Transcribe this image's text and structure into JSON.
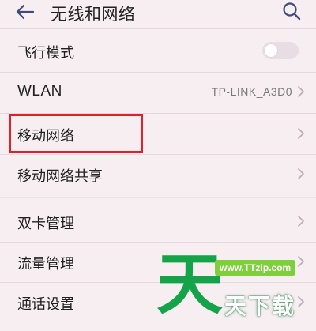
{
  "header": {
    "title": "无线和网络",
    "back_icon": "arrow-left-icon",
    "search_icon": "search-icon"
  },
  "settings": [
    {
      "label": "飞行模式",
      "type": "toggle",
      "checked": false
    },
    {
      "label": "WLAN",
      "type": "link",
      "value": "TP-LINK_A3D0"
    },
    {
      "label": "移动网络",
      "type": "link",
      "highlighted": true
    },
    {
      "label": "移动网络共享",
      "type": "link"
    },
    {
      "label": "双卡管理",
      "type": "link"
    },
    {
      "label": "流量管理",
      "type": "link"
    },
    {
      "label": "通话设置",
      "type": "link"
    }
  ],
  "watermark": {
    "url": "www.TTzip.com",
    "big": "天",
    "text": "天下载"
  },
  "colors": {
    "background": "#f7eef2",
    "highlight": "#e0202a",
    "watermark_green": "#15a34a"
  }
}
